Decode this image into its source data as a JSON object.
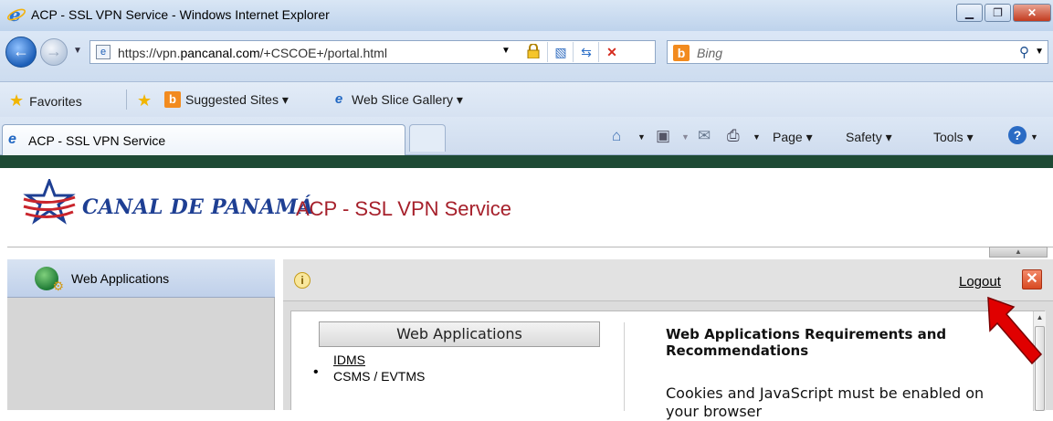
{
  "window": {
    "title": "ACP - SSL VPN Service - Windows Internet Explorer"
  },
  "address": {
    "url_prefix": "https://vpn.",
    "url_domain": "pancanal.com",
    "url_path": "/+CSCOE+/portal.html",
    "search_placeholder": "Bing"
  },
  "favorites": {
    "label": "Favorites",
    "items": [
      {
        "label": "Suggested Sites ▾"
      },
      {
        "label": "Web Slice Gallery ▾"
      }
    ]
  },
  "tabs": [
    {
      "label": "ACP - SSL VPN Service"
    }
  ],
  "commands": {
    "page": "Page ▾",
    "safety": "Safety ▾",
    "tools": "Tools ▾"
  },
  "header": {
    "brand": "CANAL DE PANAMÁ",
    "service": "ACP - SSL VPN Service"
  },
  "sidebar": {
    "items": [
      {
        "label": "Web Applications"
      }
    ]
  },
  "toolbar": {
    "logout": "Logout"
  },
  "web_apps": {
    "header": "Web Applications",
    "links": [
      {
        "label": "IDMS"
      },
      {
        "label": "CSMS / EVTMS"
      }
    ]
  },
  "requirements": {
    "title": "Web Applications Requirements and Recommendations",
    "text": "Cookies and JavaScript must be enabled on your browser"
  },
  "colors": {
    "brand_blue": "#1e3f93",
    "service_red": "#a6202b",
    "header_green": "#1e4a34",
    "annotation_arrow": "#e00000"
  }
}
